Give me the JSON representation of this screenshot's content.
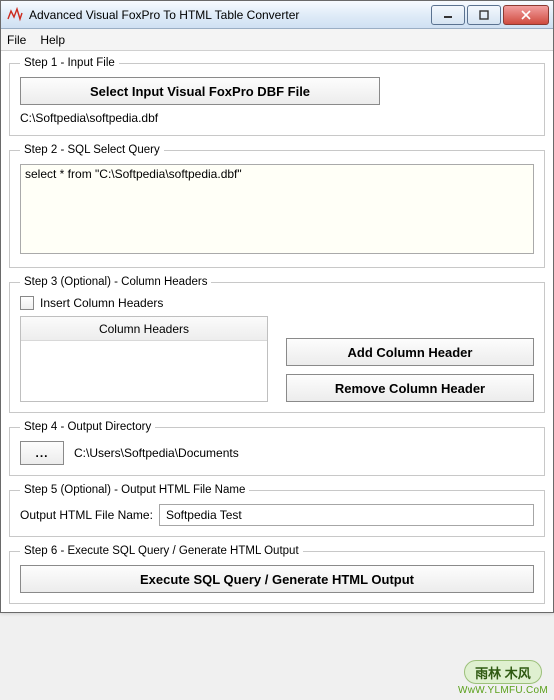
{
  "window": {
    "title": "Advanced Visual FoxPro To HTML Table Converter"
  },
  "menu": {
    "file": "File",
    "help": "Help"
  },
  "step1": {
    "legend": "Step 1 - Input File",
    "select_button": "Select Input Visual FoxPro DBF File",
    "path": "C:\\Softpedia\\softpedia.dbf"
  },
  "step2": {
    "legend": "Step 2 - SQL Select Query",
    "query": "select * from \"C:\\Softpedia\\softpedia.dbf\""
  },
  "step3": {
    "legend": "Step 3 (Optional) - Column Headers",
    "checkbox_label": "Insert Column Headers",
    "list_title": "Column Headers",
    "add_button": "Add Column Header",
    "remove_button": "Remove Column Header"
  },
  "step4": {
    "legend": "Step 4 - Output Directory",
    "browse": "...",
    "path": "C:\\Users\\Softpedia\\Documents"
  },
  "step5": {
    "legend": "Step 5 (Optional) - Output HTML File Name",
    "label": "Output HTML File Name:",
    "value": "Softpedia Test"
  },
  "step6": {
    "legend": "Step 6 - Execute SQL Query / Generate HTML Output",
    "button": "Execute SQL Query / Generate HTML Output"
  },
  "watermark": {
    "badge": "雨林 木风",
    "url": "WwW.YLMFU.CoM"
  }
}
